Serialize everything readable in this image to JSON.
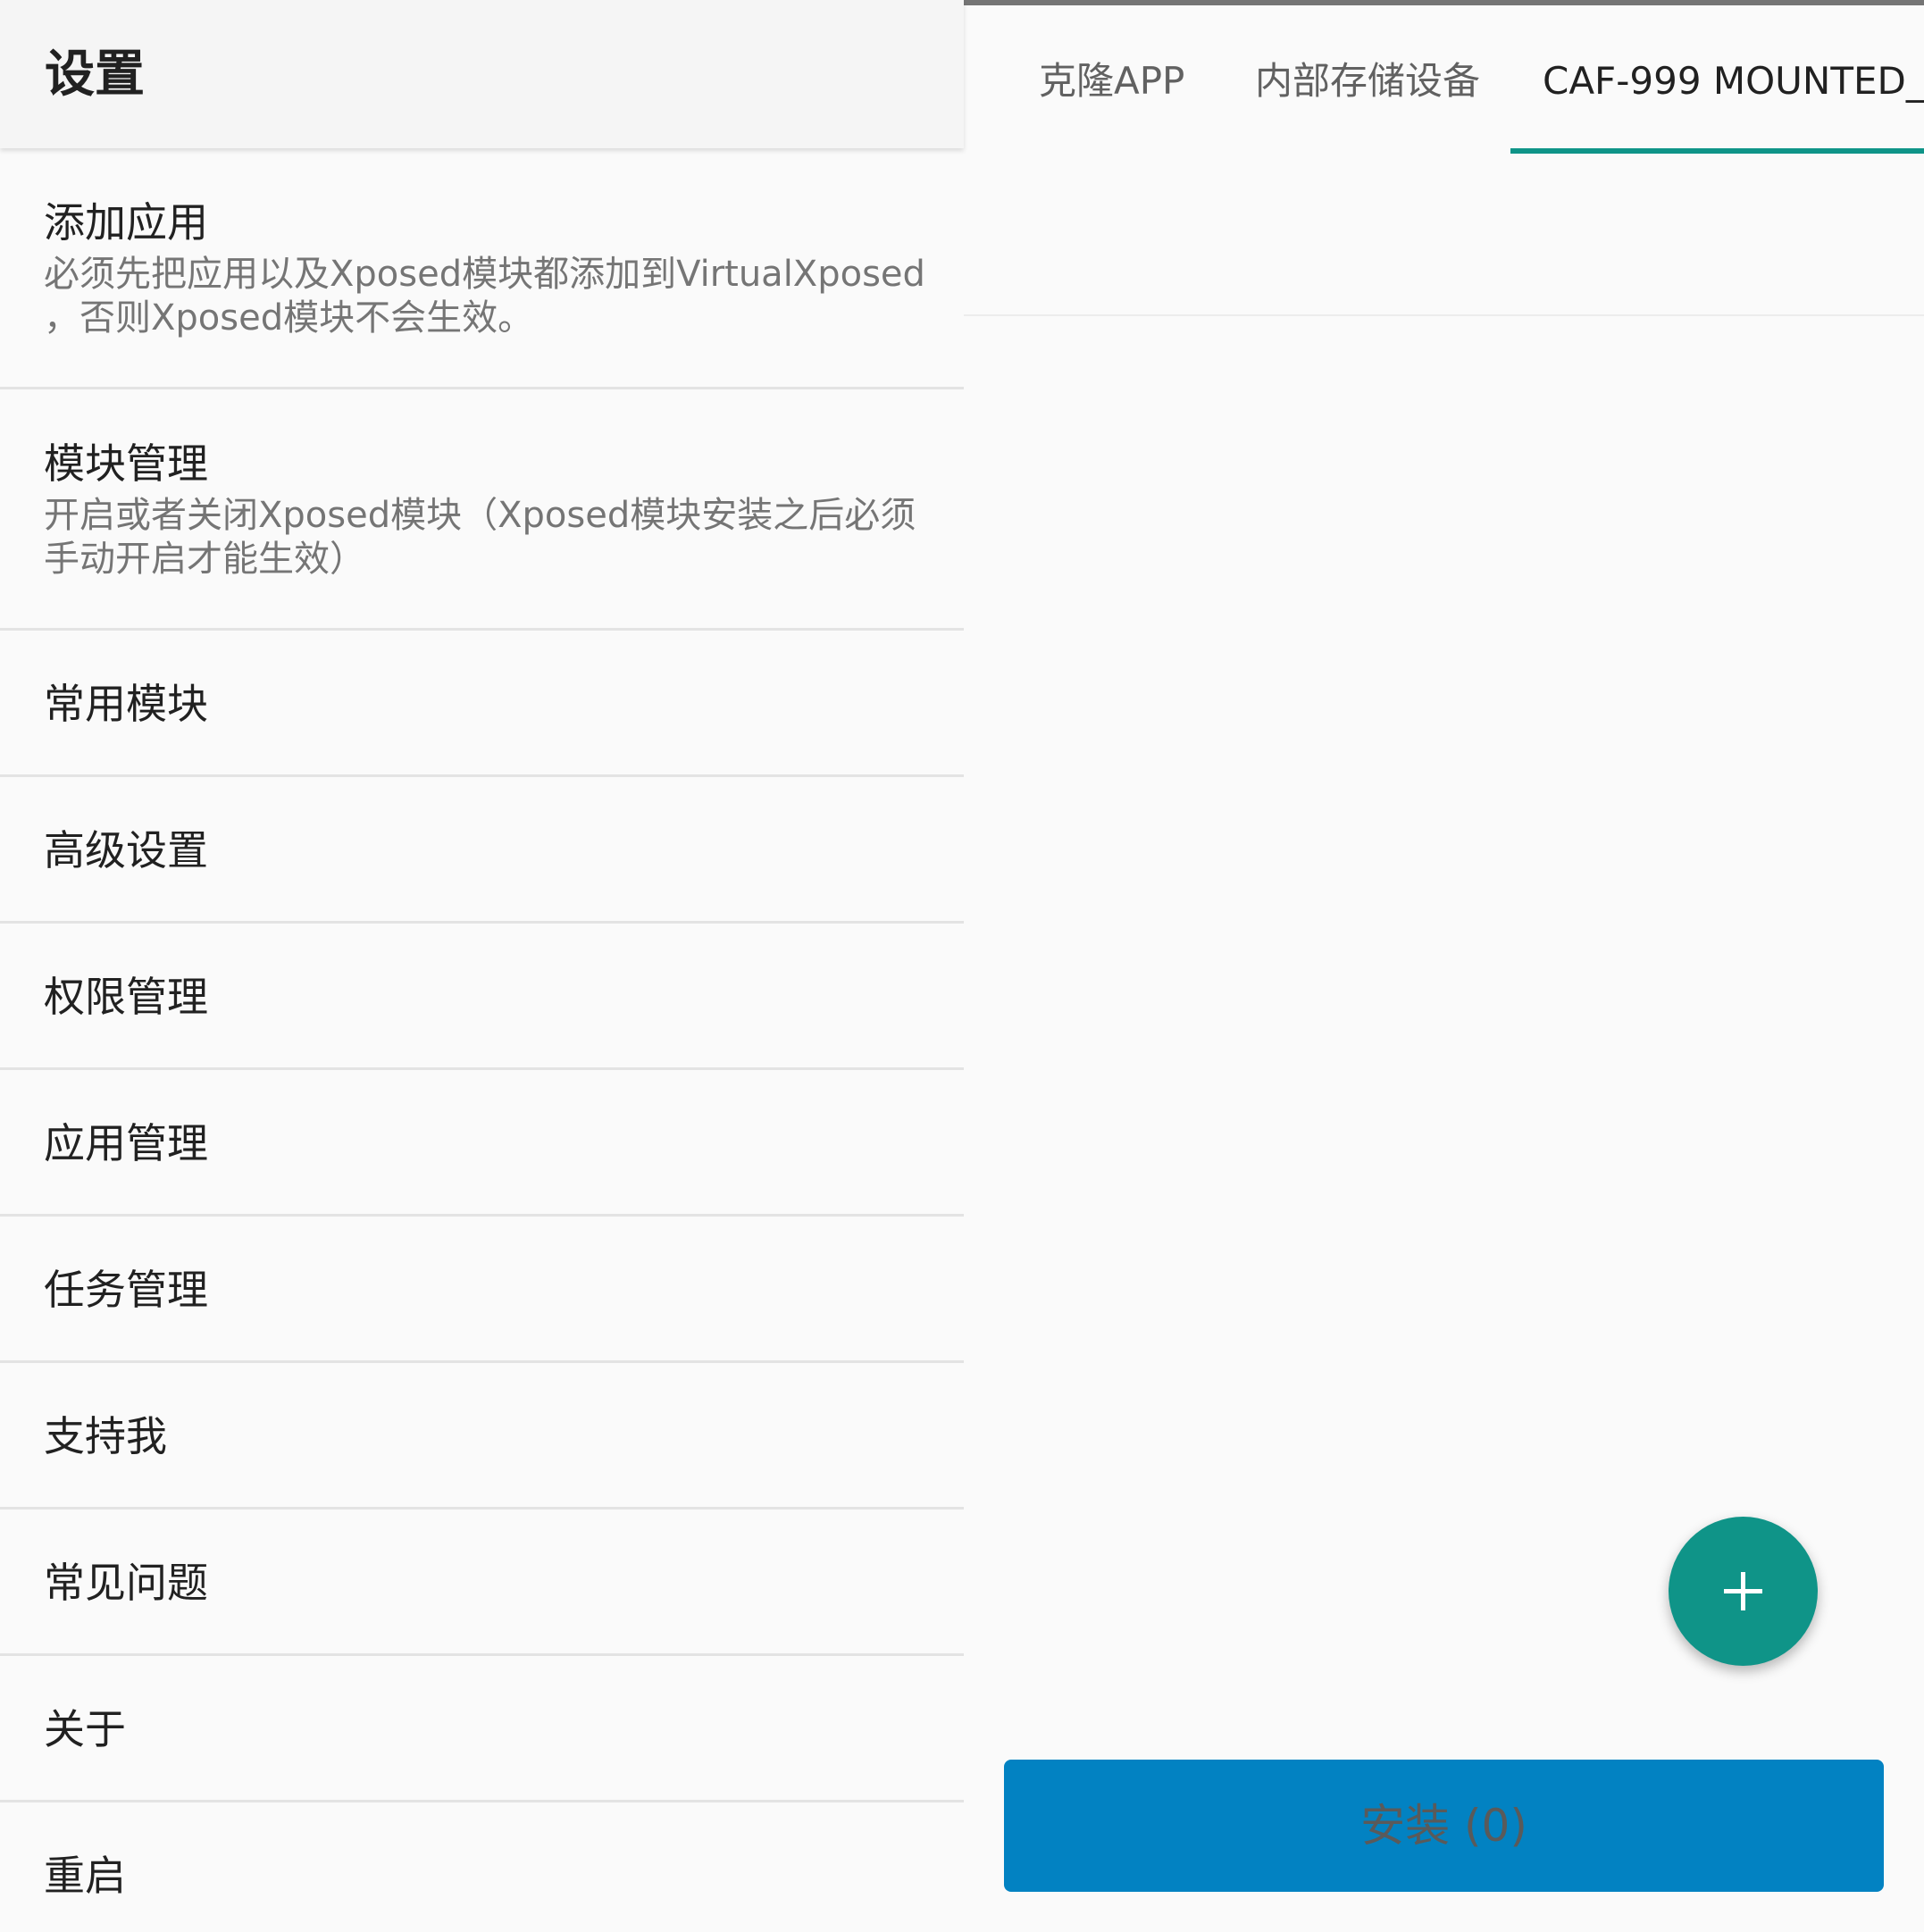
{
  "settings": {
    "title": "设置",
    "items": [
      {
        "title": "添加应用",
        "summary": "必须先把应用以及Xposed模块都添加到VirtualXposed ，否则Xposed模块不会生效。"
      },
      {
        "title": "模块管理",
        "summary": "开启或者关闭Xposed模块（Xposed模块安装之后必须手动开启才能生效）"
      },
      {
        "title": "常用模块"
      },
      {
        "title": "高级设置"
      },
      {
        "title": "权限管理"
      },
      {
        "title": "应用管理"
      },
      {
        "title": "任务管理"
      },
      {
        "title": "支持我"
      },
      {
        "title": "常见问题"
      },
      {
        "title": "关于"
      },
      {
        "title": "重启"
      }
    ]
  },
  "tabs": [
    {
      "label": "克隆APP",
      "active": false
    },
    {
      "label": "内部存储设备",
      "active": false
    },
    {
      "label": "CAF-999 MOUNTED_",
      "active": true
    }
  ],
  "fab": {
    "icon": "plus-icon"
  },
  "install_button": {
    "label": "安装 (0)"
  },
  "colors": {
    "accent": "#0f9488",
    "install_button": "#0282c2",
    "header_bg": "#f5f5f5"
  }
}
